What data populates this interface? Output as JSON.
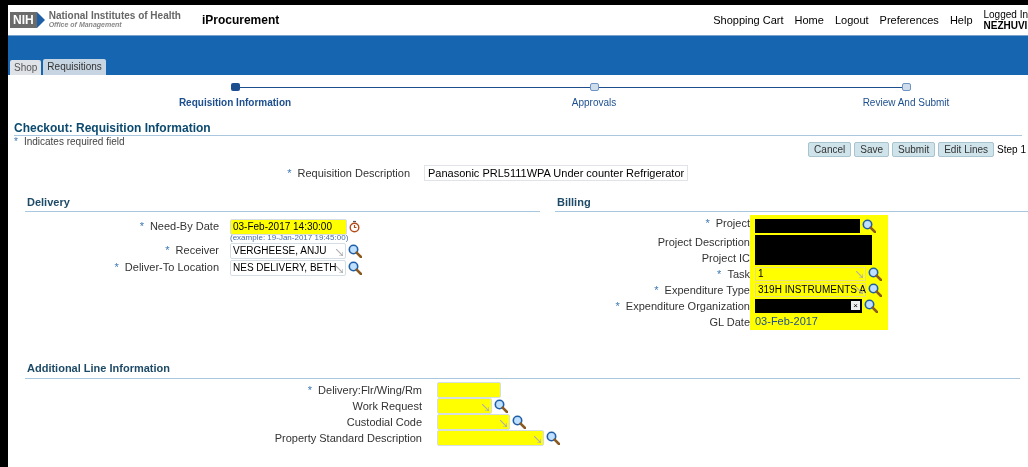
{
  "header": {
    "logo_mark": "NIH",
    "org_name": "National Institutes of Health",
    "org_sub": "Office of Management",
    "app_title": "iProcurement",
    "links": [
      "Shopping Cart",
      "Home",
      "Logout",
      "Preferences",
      "Help"
    ],
    "user_label": "Logged In",
    "user_name": "NEZHUVI"
  },
  "tabs": [
    {
      "label": "Shop",
      "selected": false
    },
    {
      "label": "Requisitions",
      "selected": true
    }
  ],
  "train": [
    {
      "label": "Requisition Information",
      "selected": true
    },
    {
      "label": "Approvals",
      "selected": false
    },
    {
      "label": "Review And Submit",
      "selected": false
    }
  ],
  "page_title": "Checkout: Requisition Information",
  "required_note": {
    "mark": "*",
    "text": "Indicates required field"
  },
  "buttons": [
    "Cancel",
    "Save",
    "Submit",
    "Edit Lines"
  ],
  "step_text": "Step 1",
  "requisition_description": {
    "label": "Requisition Description",
    "required": true,
    "value": "Panasonic PRL5111WPA Under counter Refrigerator"
  },
  "delivery": {
    "title": "Delivery",
    "fields": [
      {
        "label": "Need-By Date",
        "required": true,
        "kind": "date",
        "value": "03-Feb-2017 14:30:00",
        "highlighted": true,
        "hint": "(example: 19-Jan-2017 19:45:00)"
      },
      {
        "label": "Receiver",
        "required": true,
        "kind": "lookup",
        "value": "VERGHEESE, ANJU",
        "highlighted": false
      },
      {
        "label": "Deliver-To Location",
        "required": true,
        "kind": "lookup",
        "value": "NES DELIVERY, BETH",
        "highlighted": false
      }
    ]
  },
  "billing": {
    "title": "Billing",
    "fields": [
      {
        "label": "Project",
        "required": true,
        "kind": "redacted_lookup"
      },
      {
        "label": "Project Description",
        "required": false,
        "kind": "redacted_block"
      },
      {
        "label": "Project IC",
        "required": false,
        "kind": "covered"
      },
      {
        "label": "Task",
        "required": true,
        "kind": "lookup",
        "value": "1"
      },
      {
        "label": "Expenditure Type",
        "required": true,
        "kind": "lookup",
        "value": "319H INSTRUMENTS A"
      },
      {
        "label": "Expenditure Organization",
        "required": true,
        "kind": "redacted_clear",
        "clear_glyph": "×"
      },
      {
        "label": "GL Date",
        "required": false,
        "kind": "text",
        "value": "03-Feb-2017"
      }
    ]
  },
  "additional": {
    "title": "Additional Line Information",
    "fields": [
      {
        "label": "Delivery:Flr/Wing/Rm",
        "required": true,
        "kind": "text",
        "highlighted": true
      },
      {
        "label": "Work Request",
        "required": false,
        "kind": "lookup",
        "highlighted": true
      },
      {
        "label": "Custodial Code",
        "required": false,
        "kind": "lookup",
        "highlighted": true
      },
      {
        "label": "Property Standard Description",
        "required": false,
        "kind": "lookup",
        "highlighted": true
      }
    ]
  }
}
